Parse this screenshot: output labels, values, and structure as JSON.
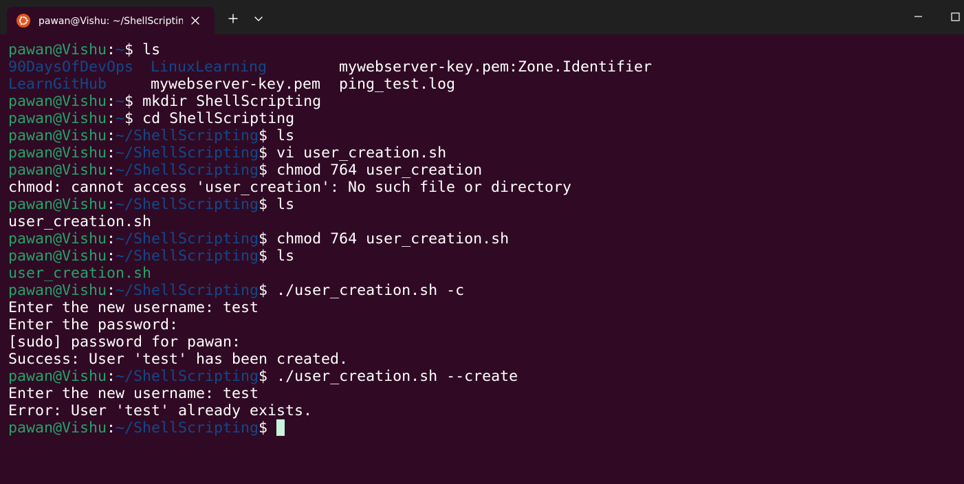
{
  "window": {
    "tab_title": "pawan@Vishu: ~/ShellScripting",
    "icons": {
      "app": "ubuntu-logo-icon",
      "close_tab": "close-icon",
      "new_tab": "plus-icon",
      "dropdown": "chevron-down-icon",
      "minimize": "minimize-icon",
      "maximize": "maximize-icon"
    }
  },
  "colors": {
    "background": "#300a24",
    "titlebar": "#202020",
    "prompt_user": "#26a269",
    "prompt_path": "#12488b",
    "cursor": "#c8f4dc"
  },
  "terminal": {
    "user_host": "pawan@Vishu",
    "home_path": "~",
    "script_path": "~/ShellScripting",
    "lines": {
      "l1_cmd": "ls",
      "l2": {
        "a": "90DaysOfDevOps",
        "b": "LinuxLearning",
        "c": "mywebserver-key.pem:Zone.Identifier"
      },
      "l3": {
        "a": "LearnGitHub",
        "b": "mywebserver-key.pem",
        "c": "ping_test.log"
      },
      "l4_cmd": "mkdir ShellScripting",
      "l5_cmd": "cd ShellScripting",
      "l6_cmd": "ls",
      "l7_cmd": "vi user_creation.sh",
      "l8_cmd": "chmod 764 user_creation",
      "l9_out": "chmod: cannot access 'user_creation': No such file or directory",
      "l10_cmd": "ls",
      "l11_out": "user_creation.sh",
      "l12_cmd": "chmod 764 user_creation.sh",
      "l13_cmd": "ls",
      "l14_out": "user_creation.sh",
      "l15_cmd": "./user_creation.sh -c",
      "l16_out": "Enter the new username: test",
      "l17_out": "Enter the password:",
      "l18_out": "[sudo] password for pawan:",
      "l19_out": "Success: User 'test' has been created.",
      "l20_cmd": "./user_creation.sh --create",
      "l21_out": "Enter the new username: test",
      "l22_out": "Error: User 'test' already exists.",
      "l23_cmd": ""
    }
  }
}
